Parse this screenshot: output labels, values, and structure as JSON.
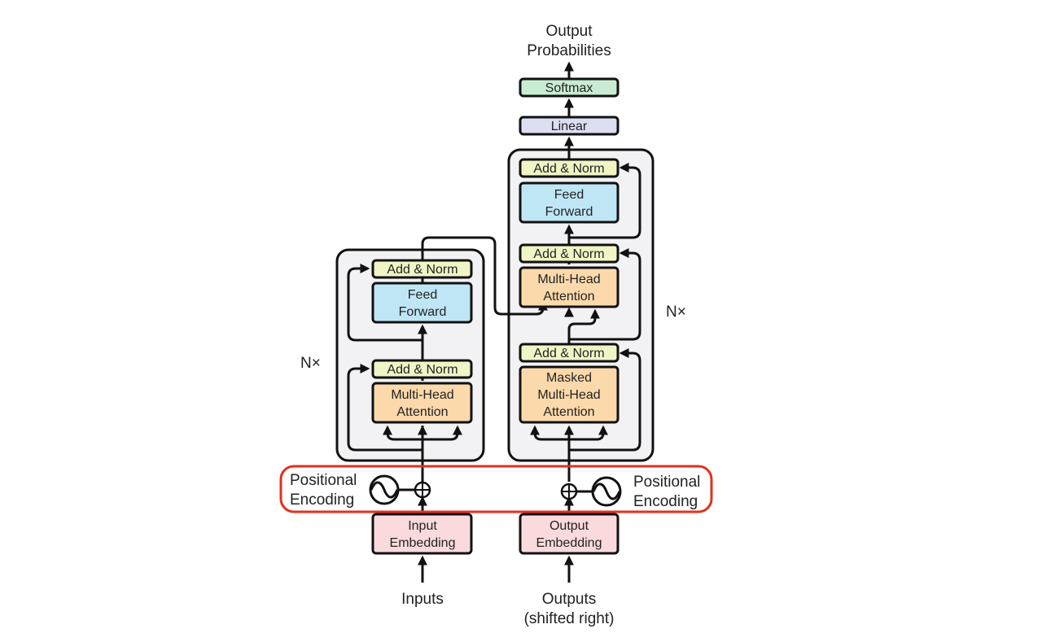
{
  "colors": {
    "add_norm": "#f1f5c5",
    "feed_forward": "#bfe6f5",
    "attention": "#fcd9ab",
    "embedding": "#fadadd",
    "linear": "#dcdff2",
    "softmax": "#c8ecd2",
    "stack_bg": "#f2f2f4",
    "highlight": "#e0321e"
  },
  "output": {
    "label_line1": "Output",
    "label_line2": "Probabilities",
    "softmax": "Softmax",
    "linear": "Linear"
  },
  "encoder": {
    "repeat_label": "N×",
    "add_norm_top": "Add & Norm",
    "feed_forward_line1": "Feed",
    "feed_forward_line2": "Forward",
    "add_norm_bottom": "Add & Norm",
    "attention_line1": "Multi-Head",
    "attention_line2": "Attention",
    "embedding_line1": "Input",
    "embedding_line2": "Embedding",
    "input_label": "Inputs",
    "pos_enc_line1": "Positional",
    "pos_enc_line2": "Encoding"
  },
  "decoder": {
    "repeat_label": "N×",
    "add_norm_top": "Add & Norm",
    "feed_forward_line1": "Feed",
    "feed_forward_line2": "Forward",
    "add_norm_mid": "Add & Norm",
    "cross_attention_line1": "Multi-Head",
    "cross_attention_line2": "Attention",
    "add_norm_bottom": "Add & Norm",
    "masked_attention_line1": "Masked",
    "masked_attention_line2": "Multi-Head",
    "masked_attention_line3": "Attention",
    "embedding_line1": "Output",
    "embedding_line2": "Embedding",
    "output_label_line1": "Outputs",
    "output_label_line2": "(shifted right)",
    "pos_enc_line1": "Positional",
    "pos_enc_line2": "Encoding"
  }
}
